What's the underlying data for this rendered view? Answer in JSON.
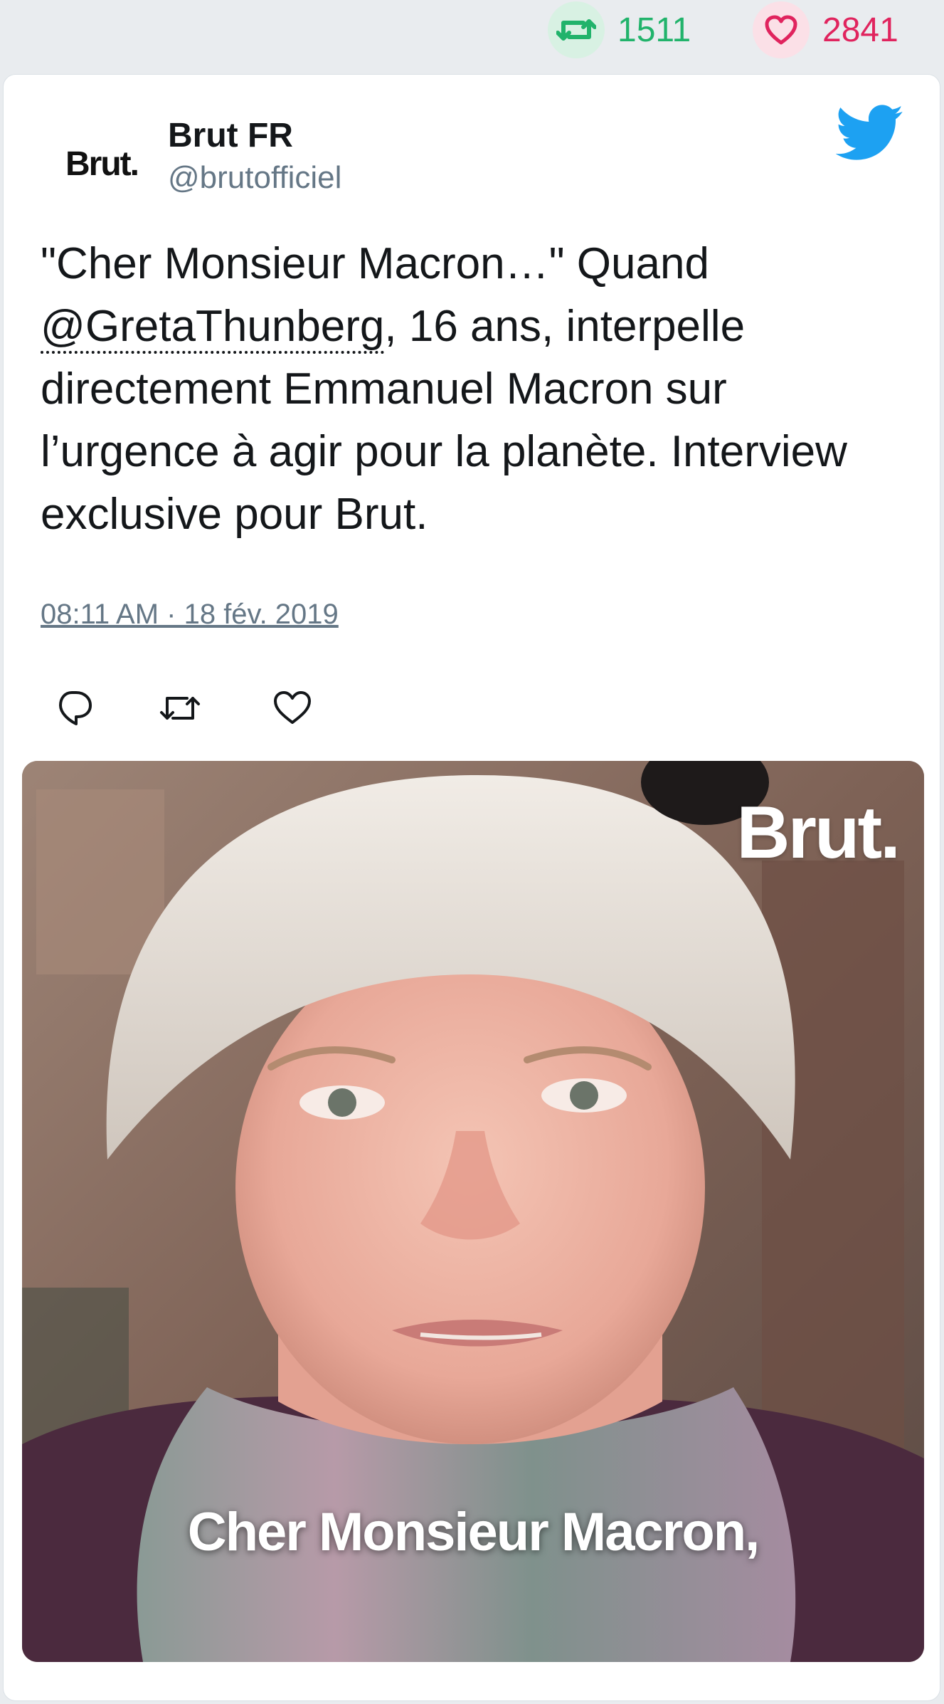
{
  "stats": {
    "retweet_count": "1511",
    "like_count": "2841",
    "retweet_icon": "retweet-icon",
    "like_icon": "heart-icon",
    "retweet_color": "#21b36b",
    "like_color": "#e0245e"
  },
  "tweet": {
    "author_name": "Brut FR",
    "author_handle": "@brutofficiel",
    "avatar_text": "Brut.",
    "text_before": "\"Cher Monsieur Macron…\" Quand ",
    "mention": "@GretaThunberg",
    "text_after": ", 16 ans, interpelle directement Emmanuel Macron sur l’urgence à agir pour la planète. Interview exclusive pour Brut.",
    "timestamp": "08:11 AM · 18 fév. 2019",
    "brand_icon": "twitter-bird-icon",
    "brand_color": "#1da1f2"
  },
  "actions": {
    "reply_icon": "reply-icon",
    "retweet_icon": "retweet-icon",
    "like_icon": "heart-icon"
  },
  "media": {
    "watermark": "Brut.",
    "caption": "Cher Monsieur Macron,"
  }
}
